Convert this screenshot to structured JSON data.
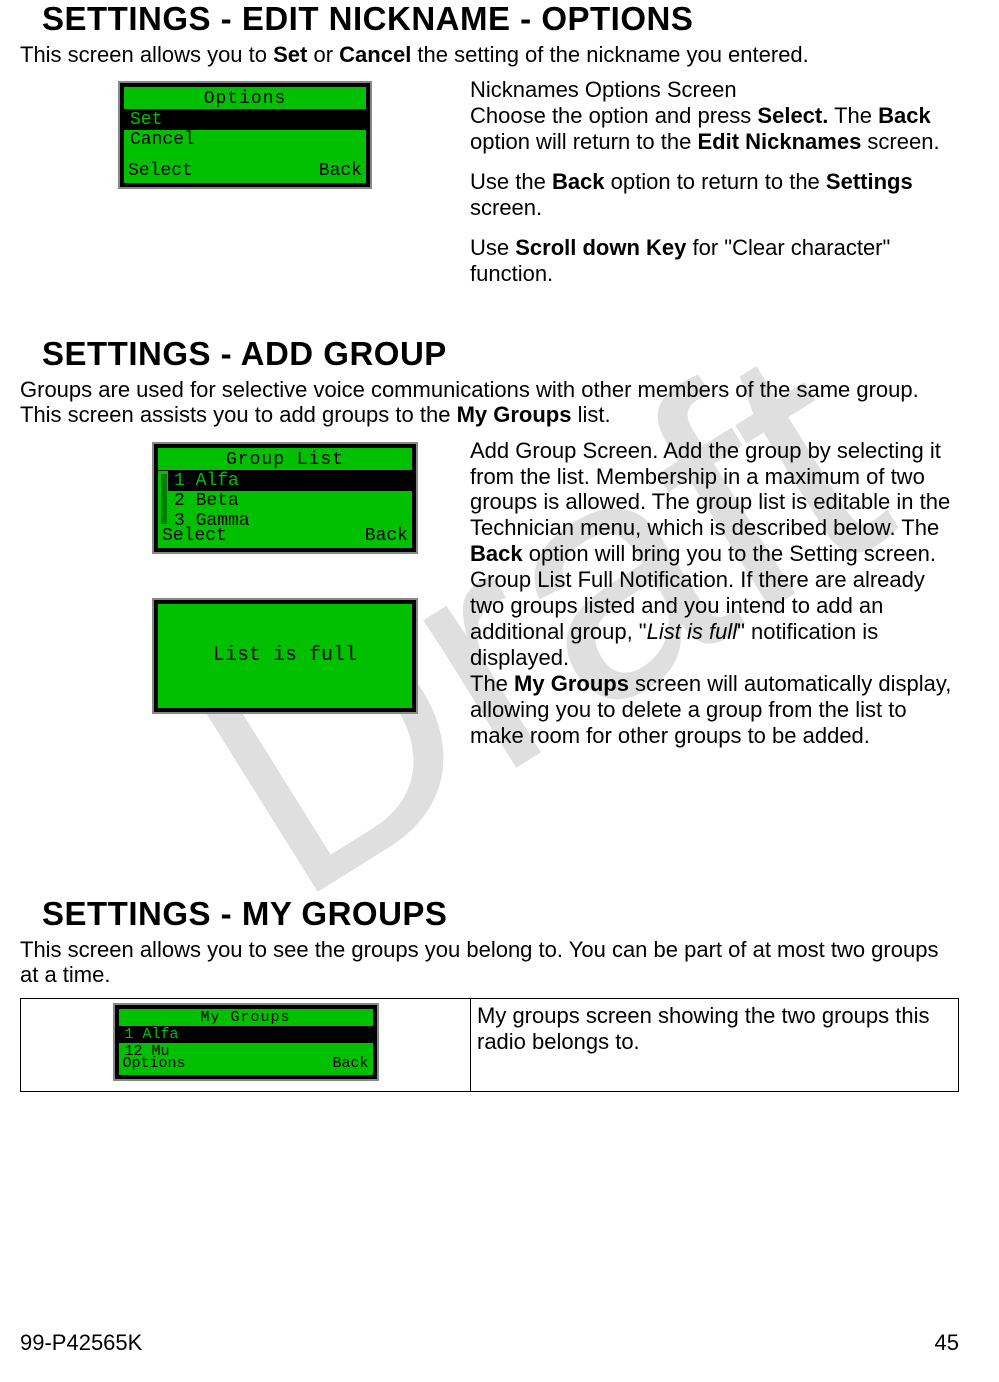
{
  "watermark": "Draft",
  "section1": {
    "heading": "SETTINGS - EDIT NICKNAME - OPTIONS",
    "intro_pre": "This screen allows you to ",
    "intro_b1": "Set",
    "intro_mid": " or ",
    "intro_b2": "Cancel",
    "intro_post": " the setting of the nickname you entered.",
    "screen": {
      "title": "Options",
      "row1": "Set",
      "row2": "Cancel",
      "soft_left": "Select",
      "soft_right": "Back"
    },
    "desc": {
      "p1_a": "Nicknames Options Screen",
      "p1_b_pre": "Choose the option and press ",
      "p1_b_b1": "Select.",
      "p1_b_mid": " The ",
      "p1_b_b2": "Back",
      "p1_b_mid2": " option will return to the ",
      "p1_b_b3": "Edit Nicknames",
      "p1_b_post": " screen.",
      "p2_pre": "Use the ",
      "p2_b1": "Back",
      "p2_mid": " option to return to the ",
      "p2_b2": "Settings",
      "p2_post": " screen.",
      "p3_pre": "Use ",
      "p3_b1": "Scroll down Key",
      "p3_post": " for \"Clear character\" function."
    }
  },
  "section2": {
    "heading": "SETTINGS - ADD GROUP",
    "intro_pre": "Groups are used for selective voice communications with other members of the same group. This screen assists you to add groups to the ",
    "intro_b1": "My Groups",
    "intro_post": " list.",
    "screen1": {
      "title": "Group List",
      "row1": "1 Alfa",
      "row2": "2 Beta",
      "row3": "3 Gamma",
      "soft_left": "Select",
      "soft_right": "Back"
    },
    "screen2": {
      "center": "List is full"
    },
    "desc": {
      "p1_pre": "Add Group Screen. Add the group by selecting it from the list. Membership in a maximum of two groups is allowed. The group list is editable in the Technician menu, which is described below. The ",
      "p1_b1": "Back",
      "p1_post": " option will bring you to the Setting screen.",
      "p2_pre": "Group List Full Notification. If there are already two groups listed and you intend to add an additional group, \"",
      "p2_i1": "List is full",
      "p2_post": "\" notification is displayed.",
      "p3_pre": "The ",
      "p3_b1": "My Groups",
      "p3_post": " screen will automatically display, allowing you to delete a group from the list to make room for other groups to be added."
    }
  },
  "section3": {
    "heading": "SETTINGS - MY GROUPS",
    "intro": "This screen allows you to see the groups you belong to. You can be part of at most two groups at a time.",
    "screen": {
      "title": "My Groups",
      "row1": "1 Alfa",
      "row2": "12 Mu",
      "soft_left": "Options",
      "soft_right": "Back"
    },
    "desc": "My groups screen showing the two groups this radio belongs to."
  },
  "footer": {
    "left": "99-P42565K",
    "right": "45"
  }
}
